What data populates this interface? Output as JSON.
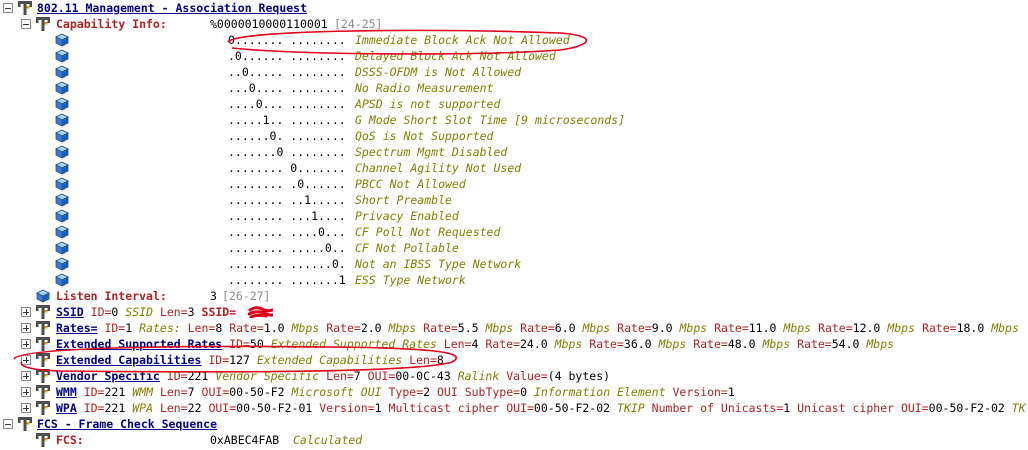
{
  "tree": {
    "assoc_request": {
      "title": "802.11 Management - Association Request"
    },
    "capability_info": {
      "label": "Capability Info:",
      "value": "%0000010000110001",
      "range": "[24-25]",
      "bits": [
        {
          "pattern": "0....... ........",
          "desc": "Immediate Block Ack Not Allowed"
        },
        {
          "pattern": ".0...... ........",
          "desc": "Delayed Block Ack Not Allowed"
        },
        {
          "pattern": "..0..... ........",
          "desc": "DSSS-OFDM is Not Allowed"
        },
        {
          "pattern": "...0.... ........",
          "desc": "No Radio Measurement"
        },
        {
          "pattern": "....0... ........",
          "desc": "APSD is not supported"
        },
        {
          "pattern": ".....1.. ........",
          "desc": "G Mode Short Slot Time [9 microseconds]"
        },
        {
          "pattern": "......0. ........",
          "desc": "QoS is Not Supported"
        },
        {
          "pattern": ".......0 ........",
          "desc": "Spectrum Mgmt Disabled"
        },
        {
          "pattern": "........ 0.......",
          "desc": "Channel Agility Not Used"
        },
        {
          "pattern": "........ .0......",
          "desc": "PBCC Not Allowed"
        },
        {
          "pattern": "........ ..1.....",
          "desc": "Short Preamble"
        },
        {
          "pattern": "........ ...1....",
          "desc": "Privacy Enabled"
        },
        {
          "pattern": "........ ....0...",
          "desc": "CF Poll Not Requested"
        },
        {
          "pattern": "........ .....0..",
          "desc": "CF Not Pollable"
        },
        {
          "pattern": "........ ......0.",
          "desc": "Not an IBSS Type Network"
        },
        {
          "pattern": "........ .......1",
          "desc": "ESS Type Network"
        }
      ]
    },
    "listen_interval": {
      "label": "Listen Interval:",
      "value": "3",
      "range": "[26-27]"
    },
    "ssid": {
      "name": "SSID",
      "k1": "ID=",
      "v1": "0",
      "desc": "SSID",
      "k2": "Len=",
      "v2": "3",
      "k3": "SSID="
    },
    "rates": {
      "name": "Rates=",
      "k1": "ID=",
      "v1": "1",
      "desc": "Rates:",
      "k2": "Len=",
      "v2": "8",
      "rate_key": "Rate=",
      "unit": "Mbps",
      "values": [
        "1.0",
        "2.0",
        "5.5",
        "6.0",
        "9.0",
        "11.0",
        "12.0",
        "18.0"
      ]
    },
    "ext_rates": {
      "name": "Extended Supported Rates",
      "k1": "ID=",
      "v1": "50",
      "desc": "Extended Supported Rates",
      "k2": "Len=",
      "v2": "4",
      "rate_key": "Rate=",
      "unit": "Mbps",
      "values": [
        "24.0",
        "36.0",
        "48.0",
        "54.0"
      ]
    },
    "ext_caps": {
      "name": "Extended Capabilities",
      "k1": "ID=",
      "v1": "127",
      "desc": "Extended Capabilities",
      "k2": "Len=",
      "v2": "8"
    },
    "vendor": {
      "name": "Vendor Specific",
      "k1": "ID=",
      "v1": "221",
      "desc": "Vendor Specific",
      "k2": "Len=",
      "v2": "7",
      "k3": "OUI=",
      "v3": "00-0C-43",
      "desc2": "Ralink",
      "k4": "Value=",
      "v4": "(4 bytes)"
    },
    "wmm": {
      "name": "WMM",
      "k1": "ID=",
      "v1": "221",
      "desc": "WMM",
      "k2": "Len=",
      "v2": "7",
      "k3": "OUI=",
      "v3": "00-50-F2",
      "desc2": "Microsoft OUI",
      "k4": "Type=",
      "v4": "2",
      "k5": "OUI SubType=",
      "v5": "0",
      "desc3": "Information Element",
      "k6": "Version=",
      "v6": "1"
    },
    "wpa": {
      "name": "WPA",
      "k1": "ID=",
      "v1": "221",
      "desc": "WPA",
      "k2": "Len=",
      "v2": "22",
      "k3": "OUI=",
      "v3": "00-50-F2-01",
      "k4": "Version=",
      "v4": "1",
      "k5": "Multicast cipher OUI=",
      "v5": "00-50-F2-02",
      "desc2": "TKIP",
      "k6": "Number of Unicasts=",
      "v6": "1",
      "k7": "Unicast cipher OUI=",
      "v7": "00-50-F2-02",
      "desc3": "TK"
    },
    "fcs_proto": {
      "title": "FCS - Frame Check Sequence"
    },
    "fcs": {
      "label": "FCS:",
      "value": "0xABEC4FAB",
      "desc": "Calculated"
    }
  },
  "colors": {
    "protocol": "#00008b",
    "field": "#b22222",
    "description": "#808000",
    "range": "#8a8a8a",
    "annotation": "#e0001b"
  },
  "icons": {
    "protocol": "tree-node-icon",
    "field": "tree-node-icon",
    "bit": "blue-cube-icon"
  }
}
